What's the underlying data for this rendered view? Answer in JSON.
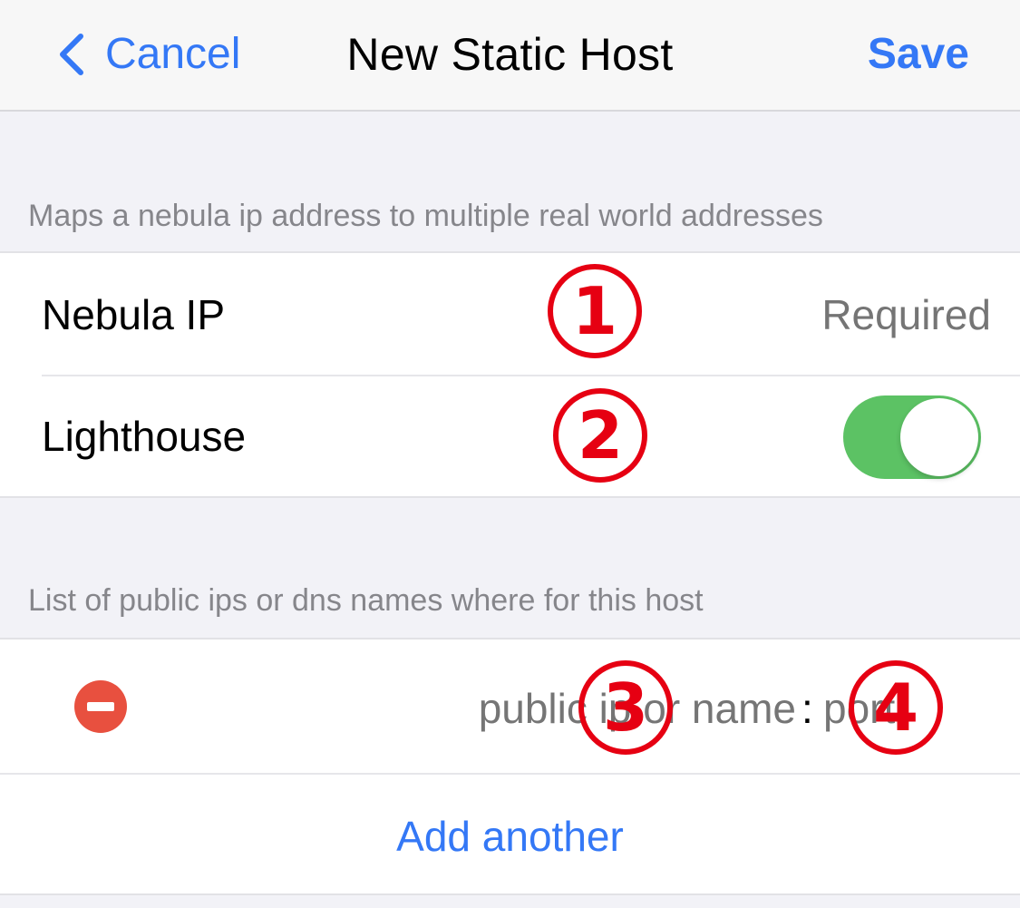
{
  "navbar": {
    "back_icon": "chevron-left-icon",
    "cancel_label": "Cancel",
    "title": "New Static Host",
    "save_label": "Save"
  },
  "host_section": {
    "header": "Maps a nebula ip address to multiple real world addresses",
    "nebula_ip": {
      "label": "Nebula IP",
      "value": "",
      "placeholder": "Required"
    },
    "lighthouse": {
      "label": "Lighthouse",
      "enabled": true
    }
  },
  "addresses_section": {
    "header": "List of public ips or dns names where for this host",
    "entries": [
      {
        "remove_icon": "minus-circle-icon",
        "host_placeholder": "public ip or name",
        "separator": ":",
        "port_placeholder": "port"
      }
    ],
    "add_another_label": "Add another"
  },
  "annotations": [
    "1",
    "2",
    "3",
    "4"
  ],
  "colors": {
    "accent": "#3478f6",
    "toggle_on": "#5cc264",
    "destructive": "#e8503f",
    "annotation": "#e60012",
    "background": "#f2f2f7"
  }
}
